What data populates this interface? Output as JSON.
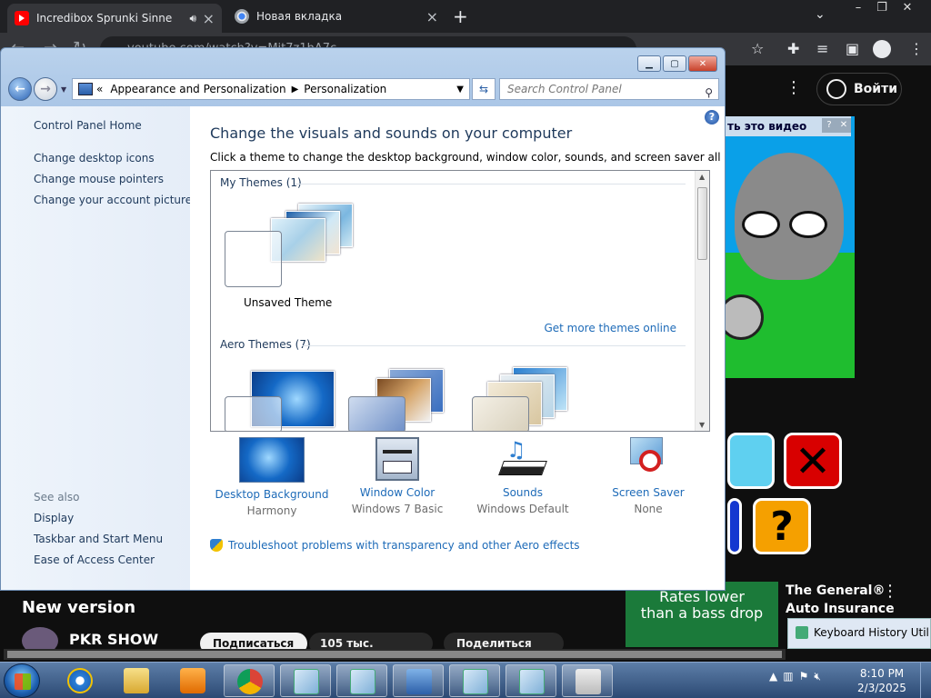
{
  "browser": {
    "tabs": [
      {
        "title": "Incredibox Sprunki Sinner Ed",
        "favicon": "youtube-icon",
        "active": true,
        "audio": true
      },
      {
        "title": "Новая вкладка",
        "favicon": "chrome-icon",
        "active": false
      }
    ],
    "omnibox_text": "youtube.com/watch?v=Mjt7z1hA7c",
    "youtube": {
      "login_label": "Войти",
      "banner_text": "ть это видео",
      "video_title": "New version",
      "channel": "PKR SHOW",
      "subscribe_label": "Подписаться",
      "likes_label": "105 тыс.",
      "share_label": "Поделиться",
      "ad": {
        "image_text_1": "Rates lower",
        "image_text_2": "than a bass drop",
        "title_1": "The General®",
        "title_2": "Auto Insurance"
      },
      "keyboard_history_label": "Keyboard History Utility"
    }
  },
  "window": {
    "breadcrumb_root_marker": "«",
    "breadcrumb": [
      "Appearance and Personalization",
      "Personalization"
    ],
    "search_placeholder": "Search Control Panel",
    "help_label": "?",
    "left_pane": {
      "home": "Control Panel Home",
      "tasks": [
        "Change desktop icons",
        "Change mouse pointers",
        "Change your account picture"
      ],
      "see_also_label": "See also",
      "see_also": [
        "Display",
        "Taskbar and Start Menu",
        "Ease of Access Center"
      ]
    },
    "heading": "Change the visuals and sounds on your computer",
    "subtitle": "Click a theme to change the desktop background, window color, sounds, and screen saver all at once.",
    "themes": {
      "my_themes_label": "My Themes (1)",
      "unsaved_theme_label": "Unsaved Theme",
      "get_more_label": "Get more themes online",
      "aero_themes_label": "Aero Themes (7)"
    },
    "options": [
      {
        "label": "Desktop Background",
        "value": "Harmony",
        "icon": "desktop-background-icon"
      },
      {
        "label": "Window Color",
        "value": "Windows 7 Basic",
        "icon": "window-color-icon"
      },
      {
        "label": "Sounds",
        "value": "Windows Default",
        "icon": "sounds-icon"
      },
      {
        "label": "Screen Saver",
        "value": "None",
        "icon": "screen-saver-icon"
      }
    ],
    "troubleshoot_label": "Troubleshoot problems with transparency and other Aero effects"
  },
  "taskbar": {
    "time": "8:10 PM",
    "date": "2/3/2025"
  },
  "colors": {
    "link": "#1e6bb8",
    "heading": "#1e395b",
    "chrome_bg": "#202124"
  }
}
